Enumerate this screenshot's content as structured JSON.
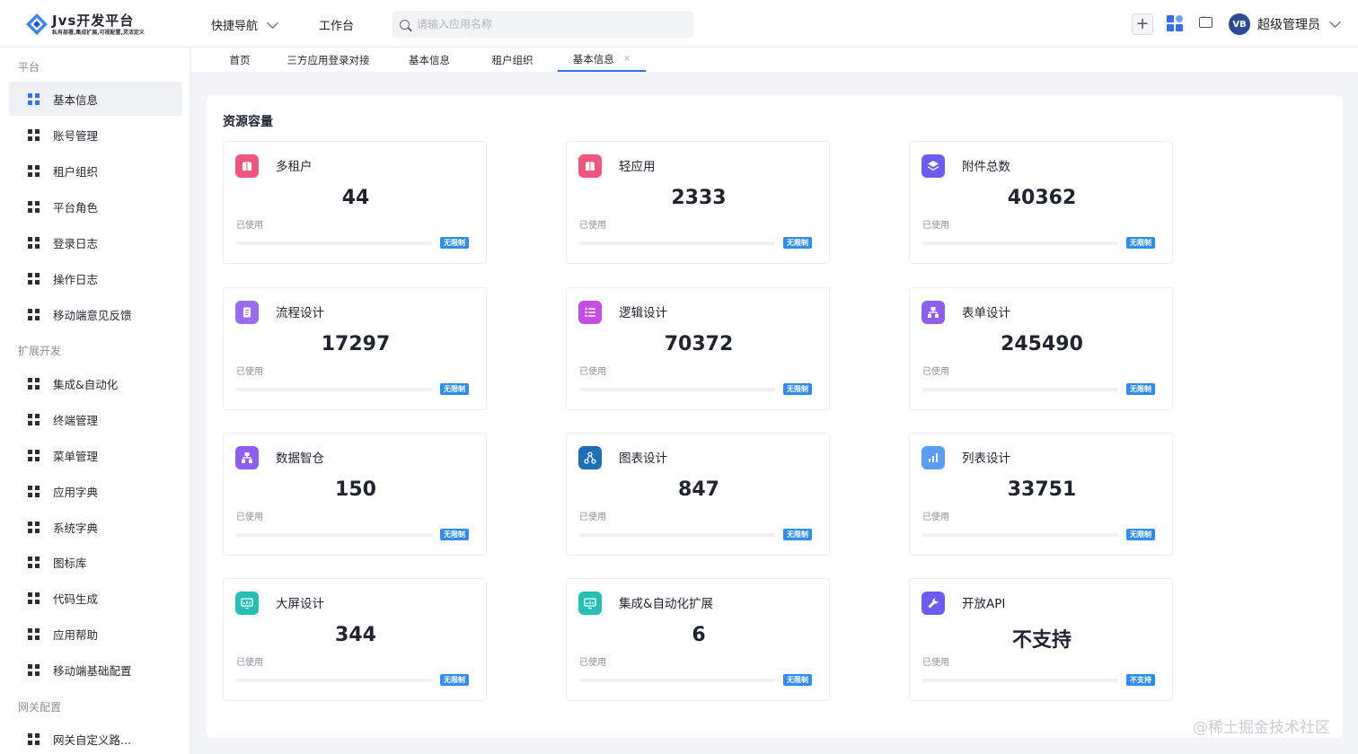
{
  "header": {
    "logo_title": "Jvs开发平台",
    "logo_subtitle": "私有部署,集成扩展,可视配置,灵活定义",
    "quick_nav": "快捷导航",
    "workbench": "工作台",
    "search_placeholder": "请输入应用名称",
    "avatar_text": "VB",
    "user_name": "超级管理员"
  },
  "sidebar": {
    "sections": [
      {
        "title": "平台",
        "items": [
          {
            "label": "基本信息",
            "active": true
          },
          {
            "label": "账号管理"
          },
          {
            "label": "租户组织"
          },
          {
            "label": "平台角色"
          },
          {
            "label": "登录日志"
          },
          {
            "label": "操作日志"
          },
          {
            "label": "移动端意见反馈"
          }
        ]
      },
      {
        "title": "扩展开发",
        "items": [
          {
            "label": "集成&自动化"
          },
          {
            "label": "终端管理"
          },
          {
            "label": "菜单管理"
          },
          {
            "label": "应用字典"
          },
          {
            "label": "系统字典"
          },
          {
            "label": "图标库"
          },
          {
            "label": "代码生成"
          },
          {
            "label": "应用帮助"
          },
          {
            "label": "移动端基础配置"
          }
        ]
      },
      {
        "title": "网关配置",
        "items": [
          {
            "label": "网关自定义路..."
          }
        ]
      }
    ]
  },
  "tabs": [
    {
      "label": "首页"
    },
    {
      "label": "三方应用登录对接"
    },
    {
      "label": "基本信息"
    },
    {
      "label": "租户组织"
    },
    {
      "label": "基本信息",
      "active": true,
      "close": "×"
    }
  ],
  "main": {
    "section_title": "资源容量",
    "used_label": "已使用",
    "cards": [
      {
        "title": "多租户",
        "value": "44",
        "badge": "无限制",
        "icon": "book-icon",
        "color": "#f0567d"
      },
      {
        "title": "轻应用",
        "value": "2333",
        "badge": "无限制",
        "icon": "book-icon",
        "color": "#f0567d"
      },
      {
        "title": "附件总数",
        "value": "40362",
        "badge": "无限制",
        "icon": "layers-icon",
        "color": "#6d5cf0"
      },
      {
        "title": "流程设计",
        "value": "17297",
        "badge": "无限制",
        "icon": "document-icon",
        "color": "#9a6cf2"
      },
      {
        "title": "逻辑设计",
        "value": "70372",
        "badge": "无限制",
        "icon": "list-icon",
        "color": "#c44de6"
      },
      {
        "title": "表单设计",
        "value": "245490",
        "badge": "无限制",
        "icon": "tree-icon",
        "color": "#8f5ef0"
      },
      {
        "title": "数据智仓",
        "value": "150",
        "badge": "无限制",
        "icon": "tree-icon",
        "color": "#8f5ef0"
      },
      {
        "title": "图表设计",
        "value": "847",
        "badge": "无限制",
        "icon": "hierarchy-icon",
        "color": "#1e6fb8"
      },
      {
        "title": "列表设计",
        "value": "33751",
        "badge": "无限制",
        "icon": "bar-chart-icon",
        "color": "#5a9df5"
      },
      {
        "title": "大屏设计",
        "value": "344",
        "badge": "无限制",
        "icon": "monitor-icon",
        "color": "#26bfb5"
      },
      {
        "title": "集成&自动化扩展",
        "value": "6",
        "badge": "无限制",
        "icon": "monitor-icon",
        "color": "#26bfb5"
      },
      {
        "title": "开放API",
        "value": "不支持",
        "badge": "不支持",
        "icon": "wrench-icon",
        "color": "#6d5cf0"
      }
    ]
  },
  "watermark": "@稀土掘金技术社区"
}
